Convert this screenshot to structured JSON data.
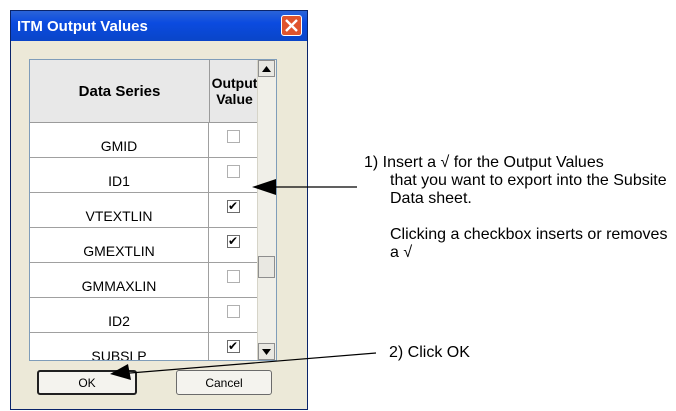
{
  "dialog": {
    "title": "ITM Output Values",
    "columns": {
      "series": "Data Series",
      "output": "Output Value"
    },
    "rows": [
      {
        "name": "GMID",
        "checked": false
      },
      {
        "name": "ID1",
        "checked": false
      },
      {
        "name": "VTEXTLIN",
        "checked": true
      },
      {
        "name": "GMEXTLIN",
        "checked": true
      },
      {
        "name": "GMMAXLIN",
        "checked": false
      },
      {
        "name": "ID2",
        "checked": false
      },
      {
        "name": "SUBSLP",
        "checked": true
      }
    ],
    "ok_label": "OK",
    "cancel_label": "Cancel"
  },
  "annotations": {
    "step1_text": "1)  Insert a √ for the Output Values",
    "step1_cont": "that you want to export into the Subsite Data sheet.",
    "step1_note": "Clicking a checkbox inserts or removes a √",
    "step2_text": "2)  Click OK"
  }
}
